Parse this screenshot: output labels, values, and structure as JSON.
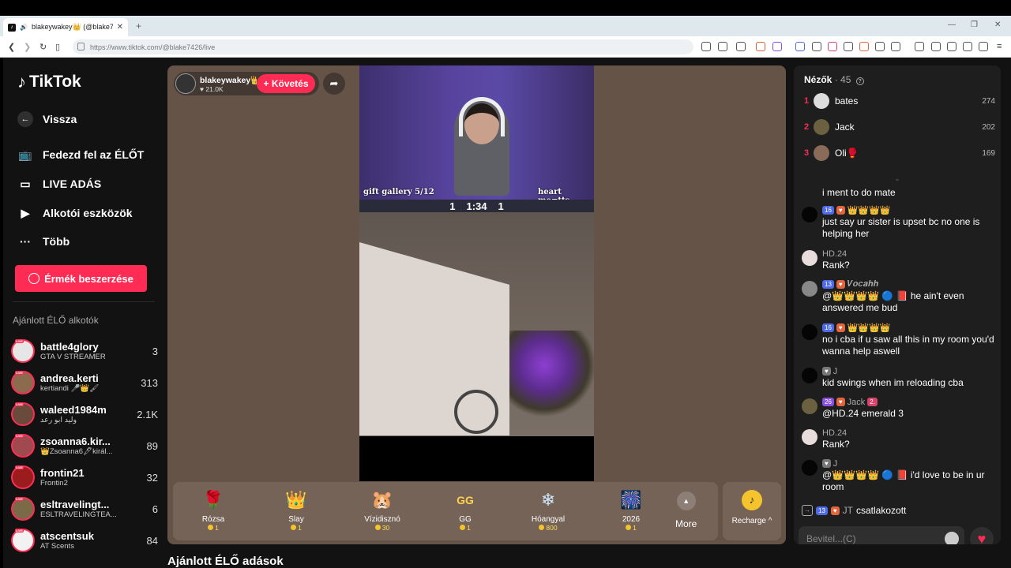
{
  "browser": {
    "tab_title": "blakeywakey👑 (@blake7426)",
    "new_tab": "+",
    "url": "https://www.tiktok.com/@blake7426/live"
  },
  "sidebar": {
    "logo": "TikTok",
    "nav": [
      {
        "label": "Vissza",
        "icon": "back-arrow-icon"
      },
      {
        "label": "Fedezd fel az ÉLŐT",
        "icon": "live-tv-icon"
      },
      {
        "label": "LIVE ADÁS",
        "icon": "camera-icon"
      },
      {
        "label": "Alkotói eszközök",
        "icon": "creator-tools-icon"
      },
      {
        "label": "Több",
        "icon": "more-dots-icon"
      }
    ],
    "coins_button": "Érmék beszerzése",
    "section_title": "Ajánlott ÉLŐ alkotók",
    "creators": [
      {
        "name": "battle4glory",
        "sub": "GTA V STREAMER",
        "count": "3"
      },
      {
        "name": "andrea.kerti",
        "sub": "kertiandi 🎤👑🖌",
        "count": "313"
      },
      {
        "name": "waleed1984m",
        "sub": "وليد ابو رعد",
        "count": "2.1K"
      },
      {
        "name": "zsoanna6.kir...",
        "sub": "👑Zsoanna6🖋királ...",
        "count": "89"
      },
      {
        "name": "frontin21",
        "sub": "Frontin2",
        "count": "32"
      },
      {
        "name": "esltravelingt...",
        "sub": "ESLTRAVELINGTEA...",
        "count": "6"
      },
      {
        "name": "atscentsuk",
        "sub": "AT Scents",
        "count": "84"
      }
    ]
  },
  "stream": {
    "host_name": "blakeywakey👑",
    "host_likes": "♥ 21.0K",
    "follow_label": "+ Követés",
    "cam_label_left": "gift gallery 5/12",
    "cam_label_right": "heart me=tts",
    "hud_left": "1",
    "hud_time": "1:34",
    "hud_right": "1"
  },
  "gifts": [
    {
      "name": "Rózsa",
      "price": "1",
      "icon": "🌹"
    },
    {
      "name": "Slay",
      "price": "1",
      "icon": "👑"
    },
    {
      "name": "Vízidisznó",
      "price": "30",
      "icon": "🐹"
    },
    {
      "name": "GG",
      "price": "1",
      "icon": "GG"
    },
    {
      "name": "Hóangyal",
      "price": "800",
      "icon": "❄"
    },
    {
      "name": "2026",
      "price": "1",
      "icon": "🎆"
    }
  ],
  "gift_more": "More",
  "recharge": "Recharge ^",
  "below_title": "Ajánlott ÉLŐ adások",
  "viewers": {
    "title": "Nézők",
    "count": "· 45",
    "list": [
      {
        "rank": "1",
        "name": "bates",
        "score": "274"
      },
      {
        "rank": "2",
        "name": "Jack",
        "score": "202"
      },
      {
        "rank": "3",
        "name": "Oli🥊",
        "score": "169"
      }
    ]
  },
  "chat": [
    {
      "meta": "",
      "text": "i ment to do mate"
    },
    {
      "lvl": "16",
      "name": "👑👑👑👑",
      "text": "just say ur sister is upset bc no one is helping her"
    },
    {
      "lvl": "",
      "name": "HD.24",
      "text": "Rank?"
    },
    {
      "lvl": "13",
      "name": "𝑽𝒐𝒄𝒂𝒉𝒉",
      "text": "@👑👑👑👑 🔵 📕 he ain't even answered me bud"
    },
    {
      "lvl": "16",
      "name": "👑👑👑👑",
      "text": "no i cba if u saw all this in my room you'd wanna help aswell"
    },
    {
      "lvl": "",
      "name": "J",
      "text": "kid swings when im reloading cba"
    },
    {
      "lvl": "26",
      "name": "Jack",
      "text": "@HD.24 emerald 3"
    },
    {
      "lvl": "",
      "name": "HD.24",
      "text": "Rank?"
    },
    {
      "lvl": "",
      "name": "J",
      "text": "@👑👑👑👑 🔵 📕 i'd love to be in ur room"
    }
  ],
  "joined": {
    "lvl": "13",
    "name": "JT",
    "text": "csatlakozott"
  },
  "input_placeholder": "Bevitel...(C)",
  "colors": {
    "accent": "#fe2c55",
    "stage": "#655347"
  }
}
